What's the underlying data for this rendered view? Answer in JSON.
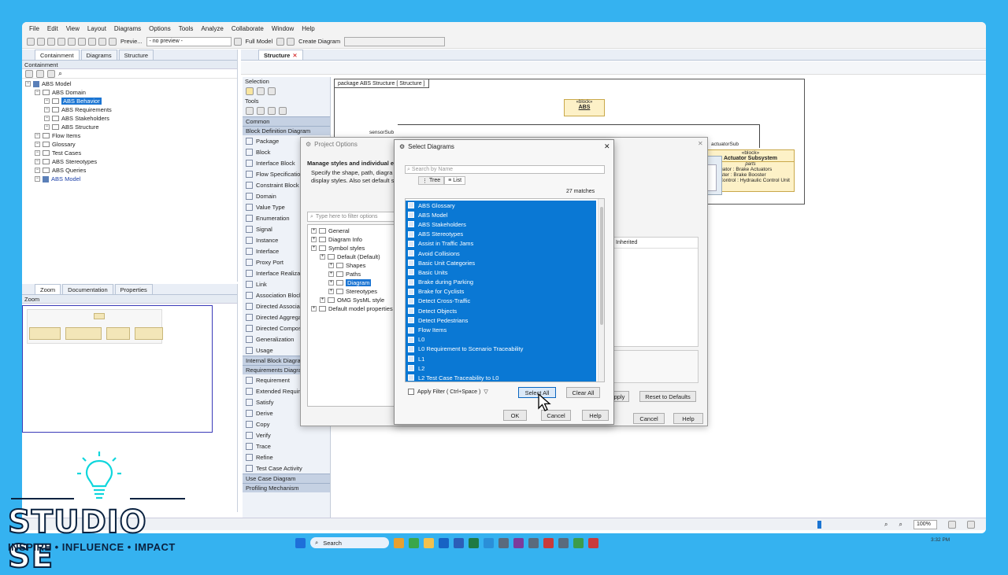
{
  "menu": [
    "File",
    "Edit",
    "View",
    "Layout",
    "Diagrams",
    "Options",
    "Tools",
    "Analyze",
    "Collaborate",
    "Window",
    "Help"
  ],
  "toolbar": {
    "preview_label": "Previe...",
    "preview_value": "- no preview -",
    "full_model": "Full Model",
    "create_diagram": "Create Diagram"
  },
  "left_tabs": [
    "Containment",
    "Diagrams",
    "Structure"
  ],
  "containment": {
    "title": "Containment",
    "tree": [
      {
        "label": "ABS Model",
        "level": 0
      },
      {
        "label": "ABS Domain",
        "level": 1
      },
      {
        "label": "ABS Behavior",
        "level": 2,
        "selected": true
      },
      {
        "label": "ABS Requirements",
        "level": 2
      },
      {
        "label": "ABS Stakeholders",
        "level": 2
      },
      {
        "label": "ABS Structure",
        "level": 2
      },
      {
        "label": "Flow Items",
        "level": 1
      },
      {
        "label": "Glossary",
        "level": 1
      },
      {
        "label": "Test Cases",
        "level": 1
      },
      {
        "label": "ABS Stereotypes",
        "level": 1
      },
      {
        "label": "ABS Queries",
        "level": 1
      },
      {
        "label": "ABS Model",
        "level": 1,
        "blue": true
      }
    ]
  },
  "bottom_tabs": [
    "Zoom",
    "Documentation",
    "Properties"
  ],
  "zoom_title": "Zoom",
  "diagram_tab": "Structure",
  "palette": {
    "selection": "Selection",
    "tools": "Tools",
    "common": "Common",
    "bdd": "Block Definition Diagram",
    "items": [
      "Package",
      "Block",
      "Interface Block",
      "Flow Specification",
      "Constraint Block",
      "Domain",
      "Value Type",
      "Enumeration",
      "Signal",
      "Instance",
      "Interface",
      "Proxy Port",
      "Interface Realization",
      "Link",
      "Association Block",
      "Directed Association",
      "Directed Aggregation",
      "Directed Composition",
      "Generalization",
      "Usage"
    ],
    "ibd": "Internal Block Diagram",
    "req": "Requirements Diagram",
    "req_items": [
      "Requirement",
      "Extended Requirement",
      "Satisfy",
      "Derive",
      "Copy",
      "Verify",
      "Trace",
      "Refine",
      "Test Case Activity"
    ],
    "ucd": "Use Case Diagram",
    "prof": "Profiling Mechanism"
  },
  "diagram": {
    "frame_label": "package ABS Structure [ Structure ]",
    "abs_stereo": "«block»",
    "abs_name": "ABS",
    "sensor_sub": "sensorSub",
    "actuator_sub": "actuatorSub",
    "element": "element",
    "act_stereo": "«block»",
    "act_name": "Actuator Subsystem",
    "act_parts": "parts",
    "act_line1": "lsActuator : Brake Actuators",
    "act_line2": "eBooster : Brake Booster",
    "act_line3": "aulicControl : Hydraulic Control Unit"
  },
  "project_options": {
    "title": "Project Options",
    "heading": "Manage styles and individual ele",
    "desc1": "Specify the shape, path, diagra",
    "desc2": "display styles. Also set default s",
    "filter_placeholder": "Type here to filter options",
    "tree": [
      {
        "label": "General",
        "level": 0
      },
      {
        "label": "Diagram Info",
        "level": 0
      },
      {
        "label": "Symbol styles",
        "level": 0
      },
      {
        "label": "Default (Default)",
        "level": 1
      },
      {
        "label": "Shapes",
        "level": 2
      },
      {
        "label": "Paths",
        "level": 2
      },
      {
        "label": "Diagram",
        "level": 2,
        "selected": true
      },
      {
        "label": "Stereotypes",
        "level": 2
      },
      {
        "label": "OMG SysML style",
        "level": 1
      },
      {
        "label": "Default model properties",
        "level": 0
      }
    ],
    "inherited": "Inherited",
    "apply": "Apply",
    "reset": "Reset to Defaults",
    "cancel": "Cancel",
    "help": "Help"
  },
  "select_diagrams": {
    "title": "Select Diagrams",
    "search_placeholder": "Search by Name",
    "tab_tree": "Tree",
    "tab_list": "List",
    "matches": "27 matches",
    "items": [
      "ABS Glossary",
      "ABS Model",
      "ABS Stakeholders",
      "ABS Stereotypes",
      "Assist in Traffic Jams",
      "Avoid Collisions",
      "Basic Unit Categories",
      "Basic Units",
      "Brake during Parking",
      "Brake for Cyclists",
      "Detect Cross-Traffic",
      "Detect Objects",
      "Detect Pedestrians",
      "Flow Items",
      "L0",
      "L0 Requirement to Scenario Traceability",
      "L1",
      "L2",
      "L2 Test Case Traceability to L0"
    ],
    "apply_filter": "Apply Filter ( Ctrl+Space )",
    "select_all": "Select All",
    "clear_all": "Clear All",
    "ok": "OK",
    "cancel": "Cancel",
    "help": "Help"
  },
  "statusbar": {
    "zoom_level": "100%",
    "time": "3:32 PM"
  },
  "taskbar": {
    "search": "Search"
  },
  "brand": {
    "name": "STUDIO SE",
    "tagline": "INSPIRE • INFLUENCE • IMPACT"
  },
  "colors": {
    "selection_blue": "#0a78d4",
    "background": "#35b2f0",
    "block_fill": "#fdf1c7"
  }
}
